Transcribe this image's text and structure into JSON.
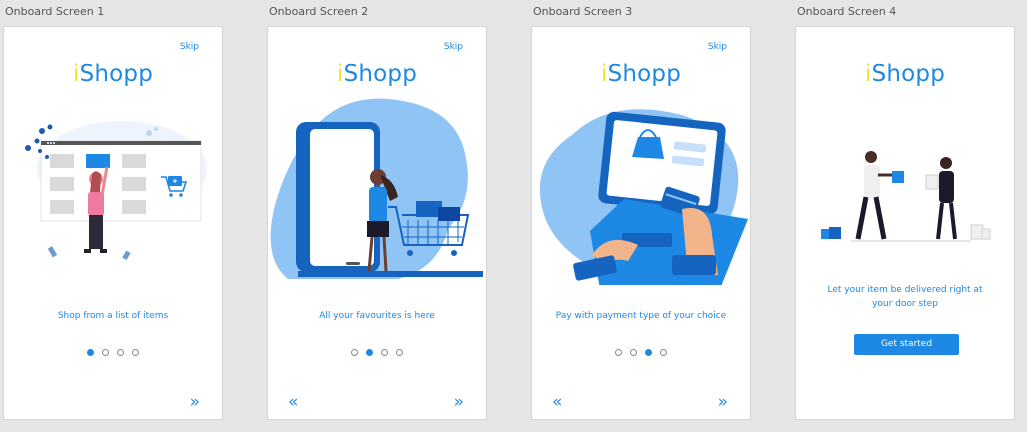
{
  "brand": {
    "prefix": "i",
    "rest": "Shopp",
    "primary": "#1e88e5",
    "accent": "#e8e82c"
  },
  "screens": [
    {
      "label": "Onboard Screen 1",
      "skip": "Skip",
      "caption": "Shop from a list of items",
      "active_dot": 1,
      "next_icon": "double-chevron-right-icon"
    },
    {
      "label": "Onboard Screen 2",
      "skip": "Skip",
      "caption": "All your favourites is here",
      "active_dot": 2,
      "prev_icon": "double-chevron-left-icon",
      "next_icon": "double-chevron-right-icon"
    },
    {
      "label": "Onboard Screen 3",
      "skip": "Skip",
      "caption": "Pay with payment type of your choice",
      "active_dot": 3,
      "prev_icon": "double-chevron-left-icon",
      "next_icon": "double-chevron-right-icon"
    },
    {
      "label": "Onboard Screen 4",
      "caption_line1": "Let your item be delivered right at",
      "caption_line2": "your door step",
      "cta": "Get started"
    }
  ]
}
